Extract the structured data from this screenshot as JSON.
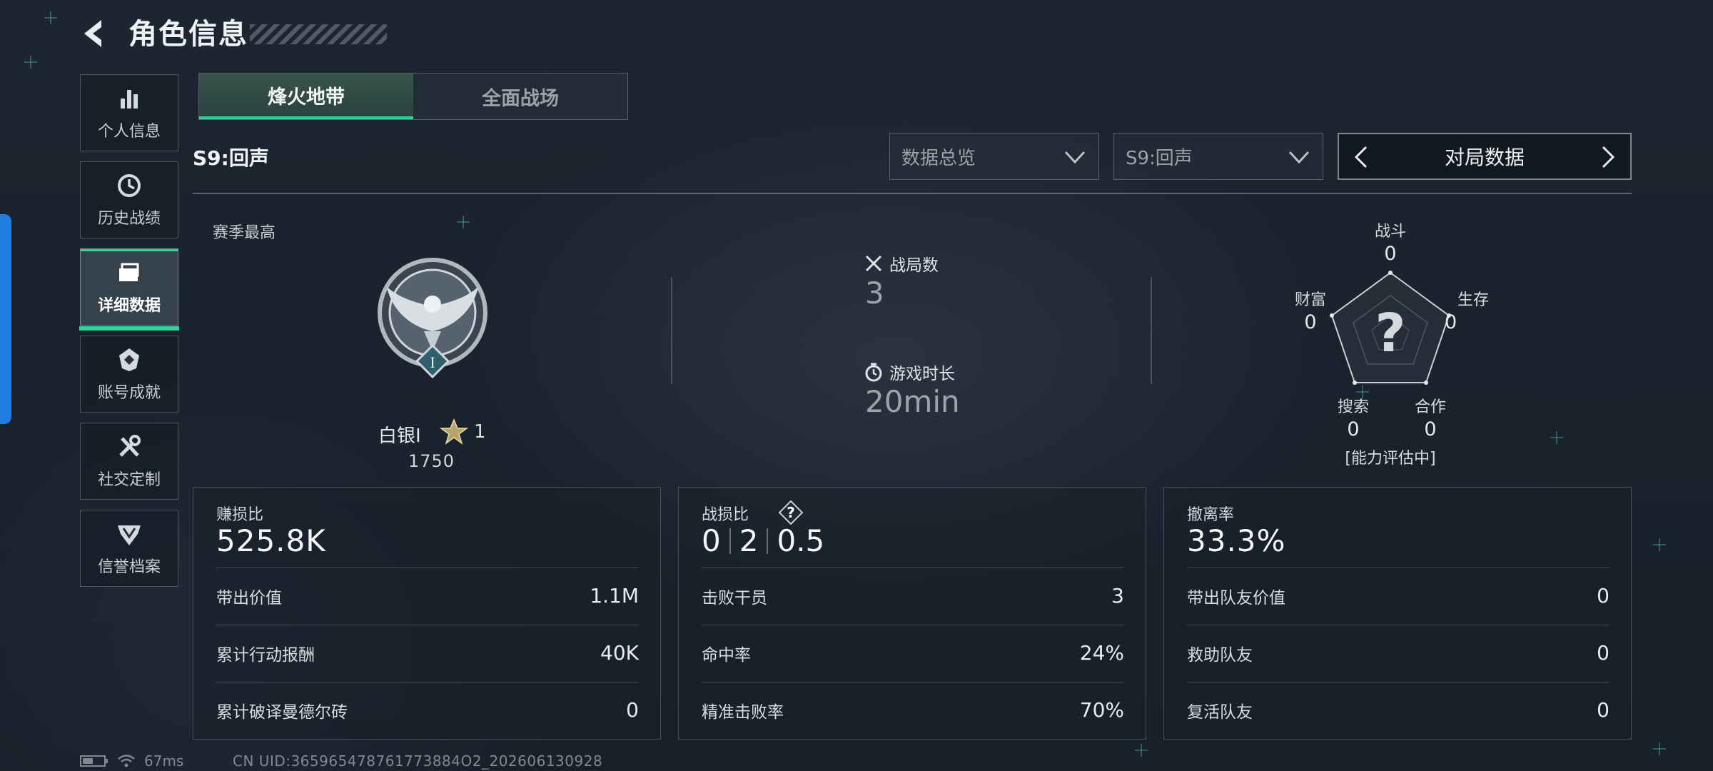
{
  "header": {
    "title": "角色信息"
  },
  "sidebar": {
    "items": [
      {
        "label": "个人信息",
        "icon": "bar-chart-icon"
      },
      {
        "label": "历史战绩",
        "icon": "clock-history-icon"
      },
      {
        "label": "详细数据",
        "icon": "folder-icon",
        "active": true
      },
      {
        "label": "账号成就",
        "icon": "badge-icon"
      },
      {
        "label": "社交定制",
        "icon": "tools-icon"
      },
      {
        "label": "信誉档案",
        "icon": "shield-emblem-icon"
      }
    ]
  },
  "mode_tabs": [
    {
      "label": "烽火地带",
      "active": true
    },
    {
      "label": "全面战场",
      "active": false
    }
  ],
  "season": {
    "label": "S9:回声"
  },
  "filters": {
    "data_type": "数据总览",
    "season": "S9:回声",
    "pager_label": "对局数据"
  },
  "summary": {
    "season_best_label": "赛季最高",
    "rank_name": "白银Ⅰ",
    "rank_roman": "I",
    "rank_stars": "1",
    "rank_score": "1750",
    "matches_label": "战局数",
    "matches_value": "3",
    "playtime_label": "游戏时长",
    "playtime_value": "20min"
  },
  "radar": {
    "axes": [
      {
        "label": "战斗",
        "value": "0"
      },
      {
        "label": "生存",
        "value": "0"
      },
      {
        "label": "合作",
        "value": "0"
      },
      {
        "label": "搜索",
        "value": "0"
      },
      {
        "label": "财富",
        "value": "0"
      }
    ],
    "center_mark": "?",
    "status": "[能力评估中]"
  },
  "panels": {
    "profit": {
      "title": "赚损比",
      "value": "525.8K",
      "rows": [
        {
          "k": "带出价值",
          "v": "1.1M"
        },
        {
          "k": "累计行动报酬",
          "v": "40K"
        },
        {
          "k": "累计破译曼德尔砖",
          "v": "0"
        }
      ]
    },
    "kd": {
      "title": "战损比",
      "help": "?",
      "values": [
        "0",
        "2",
        "0.5"
      ],
      "rows": [
        {
          "k": "击败干员",
          "v": "3"
        },
        {
          "k": "命中率",
          "v": "24%"
        },
        {
          "k": "精准击败率",
          "v": "70%"
        }
      ]
    },
    "extract": {
      "title": "撤离率",
      "value": "33.3%",
      "rows": [
        {
          "k": "带出队友价值",
          "v": "0"
        },
        {
          "k": "救助队友",
          "v": "0"
        },
        {
          "k": "复活队友",
          "v": "0"
        }
      ]
    }
  },
  "footer": {
    "ping": "67ms",
    "uid": "CN UID:365965478761773884O2_202606130928"
  },
  "colors": {
    "accent_green": "#34d399",
    "accent_blue": "#1e7fe0"
  }
}
